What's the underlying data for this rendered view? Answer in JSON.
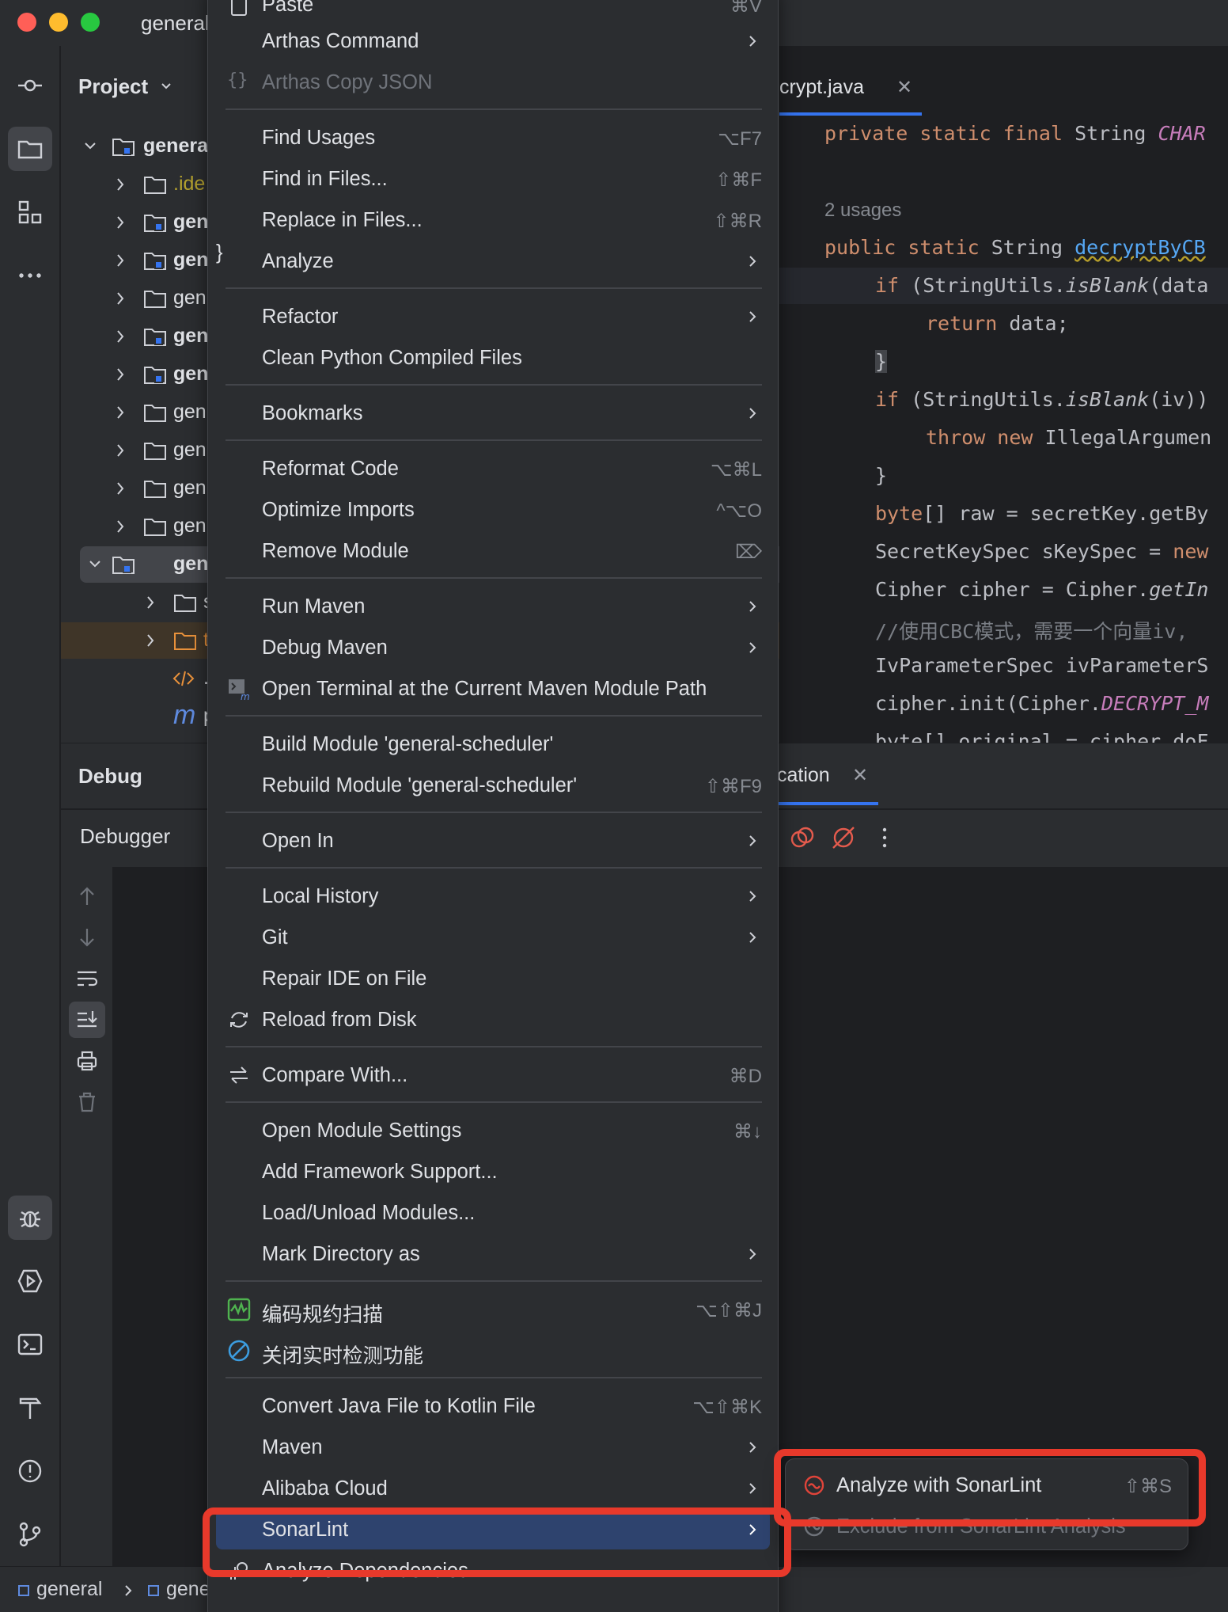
{
  "window": {
    "title": "general"
  },
  "colors": {
    "accent": "#3574f0",
    "annotation": "#e8392b",
    "menu_highlight": "#2e436e"
  },
  "project_panel": {
    "title": "Project",
    "tree": [
      {
        "label": "genera",
        "icon": "module-folder-icon"
      },
      {
        "label": ".ide",
        "icon": "folder-icon"
      },
      {
        "label": "gen",
        "icon": "module-folder-icon"
      },
      {
        "label": "gen",
        "icon": "module-folder-icon"
      },
      {
        "label": "gen",
        "icon": "folder-icon"
      },
      {
        "label": "gen",
        "icon": "module-folder-icon"
      },
      {
        "label": "gen",
        "icon": "module-folder-icon"
      },
      {
        "label": "gen",
        "icon": "folder-icon"
      },
      {
        "label": "gen",
        "icon": "folder-icon"
      },
      {
        "label": "gen",
        "icon": "folder-icon"
      },
      {
        "label": "gen",
        "icon": "folder-icon"
      },
      {
        "label": "gen",
        "icon": "module-folder-icon"
      },
      {
        "label": "s",
        "icon": "folder-icon"
      },
      {
        "label": "t",
        "icon": "folder-icon"
      },
      {
        "label": ".",
        "icon": "xml-icon"
      },
      {
        "label": "p",
        "icon": "maven-icon"
      }
    ]
  },
  "editor": {
    "tab": "crypt.java",
    "usages": "2 usages",
    "code": {
      "l1_kw": "private static final ",
      "l1_type": "String ",
      "l1_const": "CHAR",
      "l2_kw": "public static ",
      "l2_type": "String ",
      "l2_fn": "decryptByCB",
      "l3_kw": "if ",
      "l3_a": "(StringUtils.",
      "l3_it": "isBlank",
      "l3_b": "(data",
      "l4_kw": "return ",
      "l4_b": "data;",
      "l5": "}",
      "l6_kw": "if ",
      "l6_a": "(StringUtils.",
      "l6_it": "isBlank",
      "l6_b": "(iv))",
      "l7_kw": "throw new ",
      "l7_b": "IllegalArgumen",
      "l8": "}",
      "l9_kw": "byte",
      "l9_b": "[] raw = secretKey.getBy",
      "l10_a": "SecretKeySpec sKeySpec = ",
      "l10_kw": "new",
      "l11_a": "Cipher cipher = Cipher.",
      "l11_it": "getIn",
      "l12": "//使用CBC模式，需要一个向量iv,",
      "l13": "IvParameterSpec ivParameterS",
      "l14_a": "cipher.init(Cipher.",
      "l14_pur": "DECRYPT_M",
      "l15": "byte[] original = cipher.doF"
    }
  },
  "debug_panel": {
    "title": "Debug",
    "tab": "Debugger",
    "app_tab": "cation"
  },
  "status_bar": {
    "crumb1": "general",
    "crumb2": "gene"
  },
  "context_menu": {
    "items": [
      {
        "label": "Paste",
        "shortcut": "⌘V",
        "icon": "paste-icon"
      },
      {
        "label": "Arthas Command",
        "submenu": true
      },
      {
        "label": "Arthas Copy JSON",
        "icon": "braces-icon",
        "disabled": true
      },
      {
        "label": "Find Usages",
        "shortcut": "⌥F7"
      },
      {
        "label": "Find in Files...",
        "shortcut": "⇧⌘F"
      },
      {
        "label": "Replace in Files...",
        "shortcut": "⇧⌘R"
      },
      {
        "label": "Analyze",
        "submenu": true
      },
      {
        "label": "Refactor",
        "submenu": true
      },
      {
        "label": "Clean Python Compiled Files"
      },
      {
        "label": "Bookmarks",
        "submenu": true
      },
      {
        "label": "Reformat Code",
        "shortcut": "⌥⌘L"
      },
      {
        "label": "Optimize Imports",
        "shortcut": "^⌥O"
      },
      {
        "label": "Remove Module",
        "shortcut": "⌦"
      },
      {
        "label": "Run Maven",
        "submenu": true
      },
      {
        "label": "Debug Maven",
        "submenu": true
      },
      {
        "label": "Open Terminal at the Current Maven Module Path",
        "icon": "terminal-maven-icon"
      },
      {
        "label": "Build Module 'general-scheduler'"
      },
      {
        "label": "Rebuild Module 'general-scheduler'",
        "shortcut": "⇧⌘F9"
      },
      {
        "label": "Open In",
        "submenu": true
      },
      {
        "label": "Local History",
        "submenu": true
      },
      {
        "label": "Git",
        "submenu": true
      },
      {
        "label": "Repair IDE on File"
      },
      {
        "label": "Reload from Disk",
        "icon": "reload-icon"
      },
      {
        "label": "Compare With...",
        "shortcut": "⌘D",
        "icon": "compare-icon"
      },
      {
        "label": "Open Module Settings",
        "shortcut": "⌘↓"
      },
      {
        "label": "Add Framework Support..."
      },
      {
        "label": "Load/Unload Modules..."
      },
      {
        "label": "Mark Directory as",
        "submenu": true
      },
      {
        "label": "编码规约扫描",
        "shortcut": "⌥⇧⌘J",
        "icon": "code-scan-icon"
      },
      {
        "label": "关闭实时检测功能",
        "icon": "disable-icon"
      },
      {
        "label": "Convert Java File to Kotlin File",
        "shortcut": "⌥⇧⌘K"
      },
      {
        "label": "Maven",
        "submenu": true
      },
      {
        "label": "Alibaba Cloud",
        "submenu": true
      },
      {
        "label": "SonarLint",
        "submenu": true,
        "highlighted": true
      },
      {
        "label": "Analyze Dependencies...",
        "icon": "dependencies-icon"
      }
    ]
  },
  "submenu": {
    "items": [
      {
        "label": "Analyze with SonarLint",
        "shortcut": "⇧⌘S",
        "icon": "sonarlint-icon"
      },
      {
        "label": "Exclude from SonarLint Analysis",
        "icon": "sonarlint-icon",
        "disabled": true
      }
    ]
  }
}
